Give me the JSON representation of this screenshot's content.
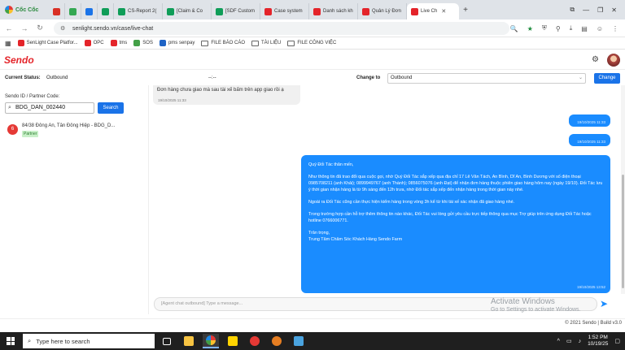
{
  "browser": {
    "brand": "Cốc Cốc",
    "tabs": [
      {
        "label": "",
        "icon": "gmail-icon",
        "color": "#d93025"
      },
      {
        "label": "",
        "icon": "app-icon",
        "color": "#34a853"
      },
      {
        "label": "",
        "icon": "messenger-icon",
        "color": "#1a73e8"
      },
      {
        "label": "",
        "icon": "doc-icon",
        "color": "#0f9d58"
      },
      {
        "label": "CS-Report 2(",
        "icon": "sheets-icon",
        "color": "#0f9d58"
      },
      {
        "label": "[Claim & Co",
        "icon": "sheets-icon",
        "color": "#0f9d58"
      },
      {
        "label": "[SDF Custom",
        "icon": "sheets-icon",
        "color": "#0f9d58"
      },
      {
        "label": "Case system",
        "icon": "sendo-icon",
        "color": "#e4242a"
      },
      {
        "label": "Danh sách kh",
        "icon": "sendo-icon",
        "color": "#e4242a"
      },
      {
        "label": "Quản Lý Đơn",
        "icon": "sendo-icon",
        "color": "#e4242a"
      },
      {
        "label": "Live Ch",
        "icon": "sendo-icon",
        "color": "#e4242a",
        "active": true
      }
    ],
    "url": "senlight.sendo.vn/case/live-chat",
    "bookmarks": [
      {
        "label": "SenLight Case Platfor...",
        "icon": "sendo-icon",
        "color": "#e4242a"
      },
      {
        "label": "OPC",
        "icon": "sendo-icon",
        "color": "#e4242a"
      },
      {
        "label": "tms",
        "icon": "sendo-icon",
        "color": "#e4242a"
      },
      {
        "label": "SOS",
        "icon": "sos-icon",
        "color": "#43a047"
      },
      {
        "label": "pms senpay",
        "icon": "senpay-icon",
        "color": "#1e63c5"
      },
      {
        "label": "FILE BÁO CÁO",
        "icon": "folder-icon",
        "color": "#666666"
      },
      {
        "label": "TÀI LIỆU",
        "icon": "folder-icon",
        "color": "#666666"
      },
      {
        "label": "FILE CÔNG VIỆC",
        "icon": "folder-icon",
        "color": "#666666"
      }
    ]
  },
  "app": {
    "logo": "Sendo",
    "current_status_label": "Current Status:",
    "current_status_value": "Outbound",
    "placeholder_dash": "--:--",
    "change_to_label": "Change to",
    "change_to_value": "Outbound",
    "change_button": "Change"
  },
  "left": {
    "partner_code_label": "Sendo ID / Partner Code:",
    "search_value": "BDG_DAN_002440",
    "search_button": "Search",
    "conversations": [
      {
        "badge": "6",
        "address": "84/38 Đông An, Tân Đông Hiệp - BDG_D...",
        "tag": "Partner"
      }
    ]
  },
  "chat": {
    "incoming": {
      "text": "Đơn hàng chưa giao mà sau tài xế bấm trên app giao rồi ạ",
      "time": "19/10/2025 11:33"
    },
    "outgoing_small": [
      {
        "time": "19/10/2025 11:33"
      },
      {
        "time": "19/10/2025 11:33"
      }
    ],
    "outgoing_big": {
      "p1": "Quý Đối Tác thân mến,",
      "p2": "Như thông tin đã trao đổi qua cuộc gọi, nhờ Quý Đối Tác sắp xếp qua địa chỉ 17 Lê Văn Tách, An Bình, Dĩ An, Bình Dương với số điện thoại 0985708211 (anh Khải); 0899949767 (anh Thành); 0856075076 (anh Đạt) để nhận đơn hàng thuộc phiên giao hàng hôm nay (ngày 19/10). Đối Tác lưu ý thời gian nhận hàng là từ 9h sáng đến 12h trưa, nhờ Đối tác sắp xếp đến nhận hàng trong thời gian này nhé.",
      "p3": "Ngoài ra Đối Tác cũng cần thực hiện kiểm hàng trong vòng 3h kể từ khi tài xế xác nhận đã giao hàng nhé.",
      "p4": "Trong trường hợp cần hỗ trợ thêm thông tin nào khác, Đối Tác vui lòng gửi yêu cầu trực tiếp thông qua mục Trợ giúp trên ứng dụng Đối Tác hoặc hotline 0766006771.",
      "p5a": "Trân trọng,",
      "p5b": "Trung Tâm Chăm Sóc Khách Hàng Sendo Farm",
      "time": "19/10/2025 13:52"
    },
    "composer_placeholder": "[Agent chat outbound] Type a message...",
    "activate_title": "Activate Windows",
    "activate_sub": "Go to Settings to activate Windows."
  },
  "footer": "© 2021 Sendo | Build v3.0",
  "taskbar": {
    "search_placeholder": "Type here to search",
    "time": "1:52 PM",
    "date": "10/19/25"
  }
}
